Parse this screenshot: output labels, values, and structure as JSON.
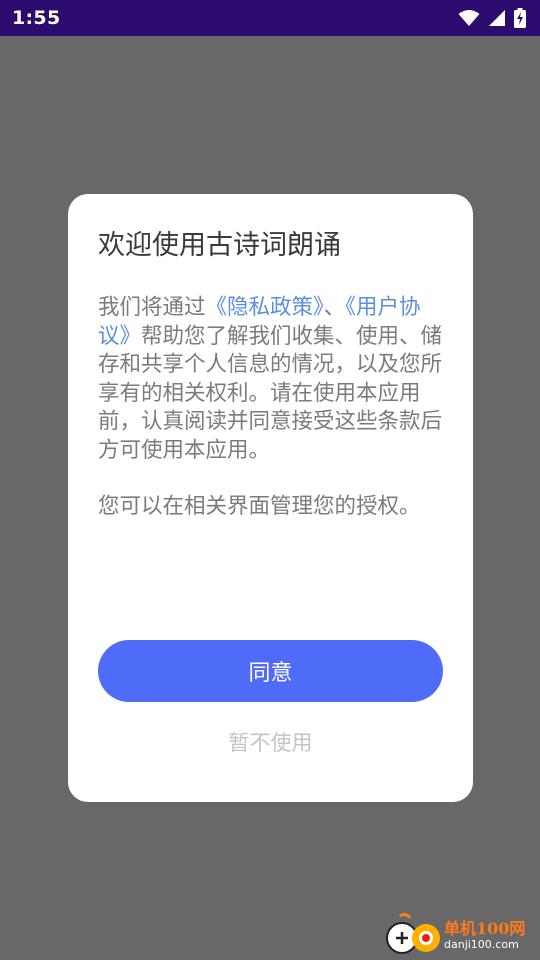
{
  "status_bar": {
    "time": "1:55",
    "icons": [
      "wifi-icon",
      "cellular-signal-icon",
      "battery-charging-icon"
    ]
  },
  "dialog": {
    "title": "欢迎使用古诗词朗诵",
    "body": {
      "p1_prefix": "我们将通过",
      "privacy_link": "《隐私政策》",
      "separator": "、",
      "user_agreement_link": "《用户协议》",
      "p1_suffix": "帮助您了解我们收集、使用、储存和共享个人信息的情况，以及您所享有的相关权利。请在使用本应用前，认真阅读并同意接受这些条款后方可使用本应用。",
      "p2": "您可以在相关界面管理您的授权。"
    },
    "agree_label": "同意",
    "decline_label": "暂不使用"
  },
  "watermark": {
    "name": "单机100网",
    "url": "danji100.com"
  },
  "colors": {
    "status_bar_bg": "#2b0c6e",
    "overlay": "#686868",
    "accent_button": "#4e6cf8",
    "link": "#5b8ee0",
    "watermark_orange": "#ff7a1a"
  }
}
